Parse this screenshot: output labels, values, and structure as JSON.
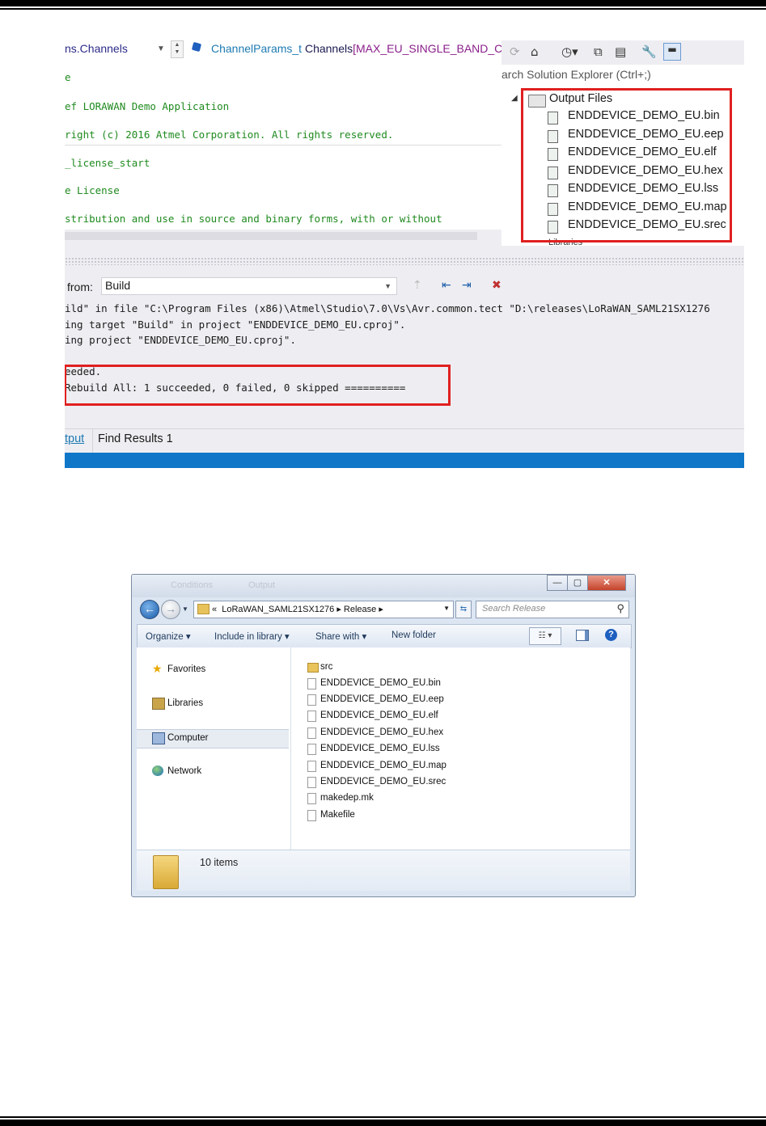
{
  "vs": {
    "nav": {
      "member": "ns.Channels",
      "type": "ChannelParams_t",
      "name": "Channels",
      "bracket": "[",
      "macro": "MAX_EU_SINGLE_BAND_CHA"
    },
    "code_lines": [
      "e",
      "ef LORAWAN Demo Application",
      "right (c) 2016 Atmel Corporation. All rights reserved.",
      "_license_start",
      "e License",
      "stribution and use in source and binary forms, with or without"
    ],
    "solution_explorer": {
      "search_placeholder": "arch Solution Explorer (Ctrl+;)",
      "folder": "Output Files",
      "files": [
        "ENDDEVICE_DEMO_EU.bin",
        "ENDDEVICE_DEMO_EU.eep",
        "ENDDEVICE_DEMO_EU.elf",
        "ENDDEVICE_DEMO_EU.hex",
        "ENDDEVICE_DEMO_EU.lss",
        "ENDDEVICE_DEMO_EU.map",
        "ENDDEVICE_DEMO_EU.srec"
      ],
      "next_item": "Libraries"
    },
    "output": {
      "from_label": "from:",
      "source": "Build",
      "lines": [
        "ild\" in file \"C:\\Program Files (x86)\\Atmel\\Studio\\7.0\\Vs\\Avr.common.tect \"D:\\releases\\LoRaWAN_SAML21SX1276",
        "ing target \"Build\" in project \"ENDDEVICE_DEMO_EU.cproj\".",
        "ing project \"ENDDEVICE_DEMO_EU.cproj\".",
        "",
        "eeded.",
        " Rebuild All: 1 succeeded, 0 failed, 0 skipped =========="
      ]
    },
    "tabs": [
      "tput",
      "Find Results 1"
    ],
    "colors": {
      "highlight": "#e02020",
      "statusbar": "#0f76c8"
    }
  },
  "explorer": {
    "ghost_tabs": [
      "Conditions",
      "Output"
    ],
    "address": {
      "breadcrumb_prefix": "«",
      "segments": [
        "LoRaWAN_SAML21SX1276",
        "Release"
      ]
    },
    "search_placeholder": "Search Release",
    "toolbar": {
      "organize": "Organize",
      "include": "Include in library",
      "share": "Share with",
      "newfolder": "New folder"
    },
    "nav": [
      "Favorites",
      "Libraries",
      "Computer",
      "Network"
    ],
    "files": [
      {
        "name": "src",
        "type": "folder"
      },
      {
        "name": "ENDDEVICE_DEMO_EU.bin",
        "type": "file"
      },
      {
        "name": "ENDDEVICE_DEMO_EU.eep",
        "type": "file"
      },
      {
        "name": "ENDDEVICE_DEMO_EU.elf",
        "type": "file"
      },
      {
        "name": "ENDDEVICE_DEMO_EU.hex",
        "type": "file"
      },
      {
        "name": "ENDDEVICE_DEMO_EU.lss",
        "type": "file"
      },
      {
        "name": "ENDDEVICE_DEMO_EU.map",
        "type": "file"
      },
      {
        "name": "ENDDEVICE_DEMO_EU.srec",
        "type": "file"
      },
      {
        "name": "makedep.mk",
        "type": "file"
      },
      {
        "name": "Makefile",
        "type": "file"
      }
    ],
    "status": "10 items"
  }
}
